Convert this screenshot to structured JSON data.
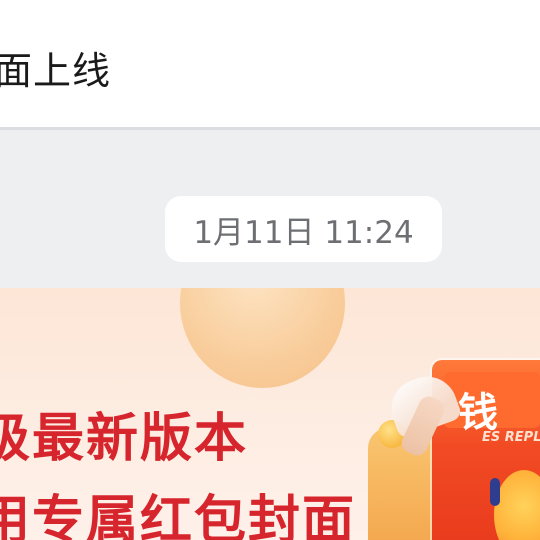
{
  "header": {
    "title": "面上线"
  },
  "chat": {
    "timestamp": "1月11日 11:24"
  },
  "banner": {
    "line1": "级最新版本",
    "line2": "用专属红包封面",
    "cover_glyph": "钱",
    "cover_tag": "ES REPL",
    "accent_color": "#d6252c",
    "cover_color": "#f24b24"
  }
}
